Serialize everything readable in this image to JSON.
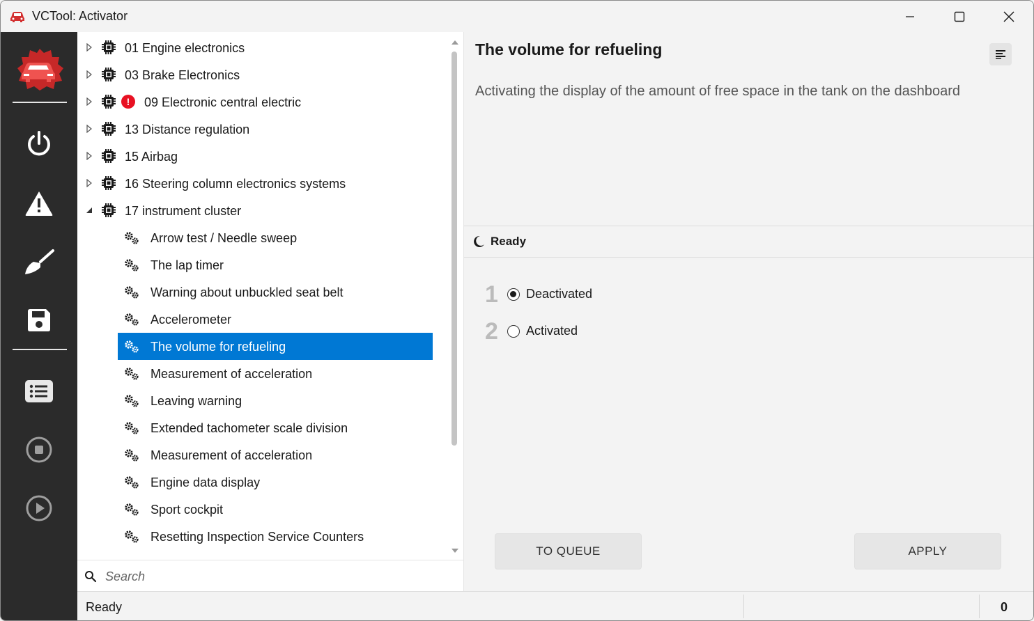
{
  "window": {
    "title": "VCTool: Activator",
    "accent_color": "#0078d4",
    "rail_color": "#2b2b2b",
    "error_color": "#e81123"
  },
  "rail": {
    "items": [
      {
        "icon": "power-icon"
      },
      {
        "icon": "warning-icon"
      },
      {
        "icon": "brush-icon"
      },
      {
        "icon": "save-icon"
      },
      {
        "icon": "list-icon"
      },
      {
        "icon": "stop-icon"
      },
      {
        "icon": "play-icon"
      }
    ]
  },
  "tree": {
    "modules": [
      {
        "label": "01  Engine electronics",
        "expanded": false,
        "error": false
      },
      {
        "label": "03  Brake Electronics",
        "expanded": false,
        "error": false
      },
      {
        "label": "09  Electronic central electric",
        "expanded": false,
        "error": true,
        "error_mark": "!"
      },
      {
        "label": "13  Distance regulation",
        "expanded": false,
        "error": false
      },
      {
        "label": "15  Airbag",
        "expanded": false,
        "error": false
      },
      {
        "label": "16  Steering column electronics systems",
        "expanded": false,
        "error": false
      },
      {
        "label": "17  instrument cluster",
        "expanded": true,
        "error": false
      }
    ],
    "functions": [
      {
        "label": "Arrow test / Needle sweep",
        "selected": false
      },
      {
        "label": "The lap timer",
        "selected": false
      },
      {
        "label": "Warning about unbuckled seat belt",
        "selected": false
      },
      {
        "label": "Accelerometer",
        "selected": false
      },
      {
        "label": "The volume for refueling",
        "selected": true
      },
      {
        "label": "Measurement of acceleration",
        "selected": false
      },
      {
        "label": "Leaving warning",
        "selected": false
      },
      {
        "label": "Extended tachometer scale division",
        "selected": false
      },
      {
        "label": "Measurement of acceleration",
        "selected": false
      },
      {
        "label": "Engine data display",
        "selected": false
      },
      {
        "label": "Sport cockpit",
        "selected": false
      },
      {
        "label": "Resetting Inspection Service Counters",
        "selected": false
      }
    ]
  },
  "search": {
    "placeholder": "Search",
    "value": ""
  },
  "detail": {
    "title": "The volume for refueling",
    "description": "Activating the display of the amount of free space in the tank on the dashboard",
    "state": "Ready",
    "options": [
      {
        "number": "1",
        "label": "Deactivated",
        "checked": true
      },
      {
        "number": "2",
        "label": "Activated",
        "checked": false
      }
    ],
    "queue_label": "TO QUEUE",
    "apply_label": "APPLY"
  },
  "status": {
    "text": "Ready",
    "count": "0"
  }
}
